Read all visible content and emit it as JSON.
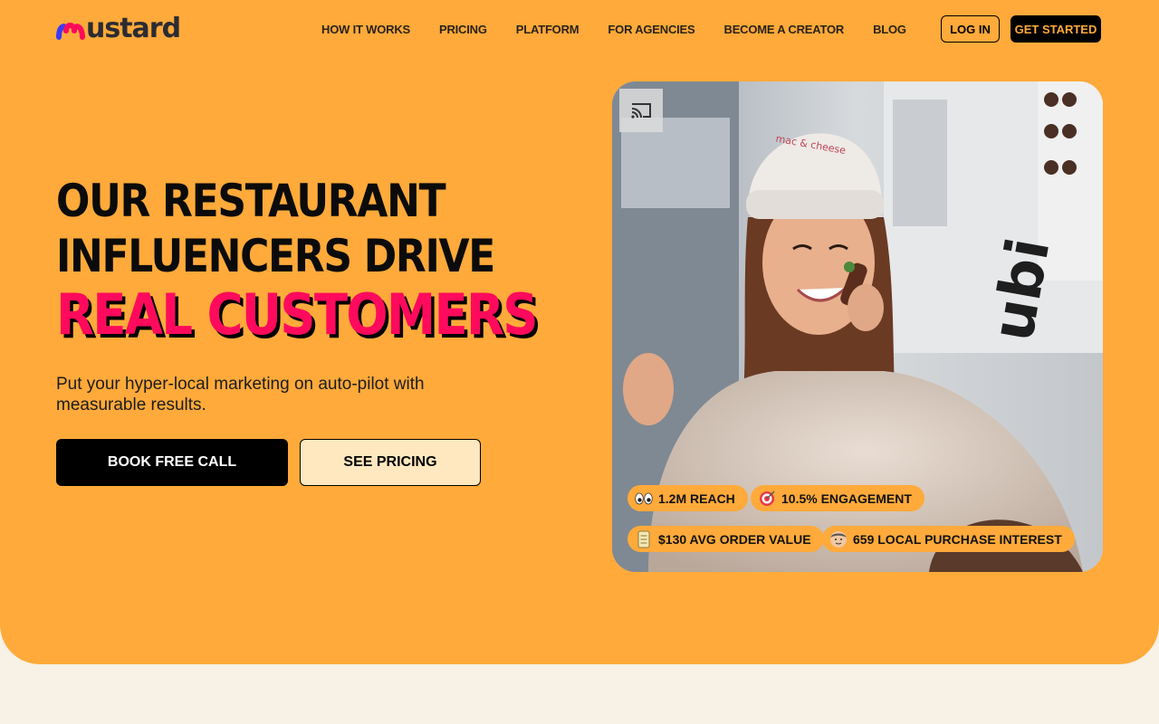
{
  "brand": {
    "name": "ustard",
    "logo_colors": [
      "#3b3bf5",
      "#ff0a5c",
      "#ffaa3a"
    ]
  },
  "nav": {
    "links": [
      {
        "label": "HOW IT WORKS"
      },
      {
        "label": "PRICING"
      },
      {
        "label": "PLATFORM"
      },
      {
        "label": "FOR AGENCIES"
      },
      {
        "label": "BECOME A CREATOR"
      },
      {
        "label": "BLOG"
      }
    ],
    "login_label": "LOG IN",
    "get_started_label": "GET STARTED"
  },
  "hero": {
    "headline_line1": "OUR RESTAURANT",
    "headline_line2": "INFLUENCERS DRIVE",
    "headline_accent": "REAL CUSTOMERS",
    "subtext": "Put your hyper-local marketing on auto-pilot with measurable results.",
    "primary_cta": "BOOK FREE CALL",
    "secondary_cta": "SEE PRICING"
  },
  "video": {
    "stats": {
      "reach": {
        "icon": "eyes-icon",
        "label": "1.2M REACH"
      },
      "engagement": {
        "icon": "target-icon",
        "label": "10.5% ENGAGEMENT"
      },
      "order_value": {
        "icon": "receipt-icon",
        "label": "$130 AVG ORDER VALUE"
      },
      "purchase_interest": {
        "icon": "person-icon",
        "label": "659 LOCAL PURCHASE INTEREST"
      }
    }
  },
  "colors": {
    "hero_bg": "#ffaa3a",
    "page_bg": "#f7f1e6",
    "accent": "#ff0a5c",
    "pricing_button_bg": "#ffe8bf"
  }
}
